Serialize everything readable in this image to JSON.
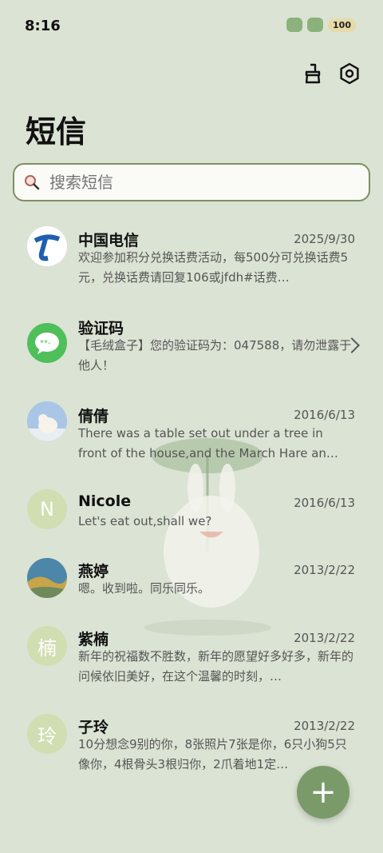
{
  "status": {
    "time": "8:16",
    "battery": "100"
  },
  "header": {
    "title": "短信"
  },
  "search": {
    "placeholder": "搜索短信"
  },
  "messages": [
    {
      "name": "中国电信",
      "date": "2025/9/30",
      "preview": "欢迎参加积分兑换话费活动，每500分可兑换话费5元，兑换话费请回复106或jfdh#话费…",
      "avatar": "telecom-logo"
    },
    {
      "name": "验证码",
      "date": "",
      "preview": "【毛绒盒子】您的验证码为：047588，请勿泄露于他人！",
      "avatar": "message-icon"
    },
    {
      "name": "倩倩",
      "date": "2016/6/13",
      "preview": "There was a table set out under a tree in front of the house,and the March Hare an…",
      "avatar": "polar-bear-photo"
    },
    {
      "name": "Nicole",
      "date": "2016/6/13",
      "preview": "Let's eat out,shall we?",
      "avatar_letter": "N"
    },
    {
      "name": "燕婷",
      "date": "2013/2/22",
      "preview": "嗯。收到啦。同乐同乐。",
      "avatar": "landscape-photo"
    },
    {
      "name": "紫楠",
      "date": "2013/2/22",
      "preview": "新年的祝福数不胜数，新年的愿望好多好多，新年的问候依旧美好，在这个温馨的时刻，…",
      "avatar_letter": "楠"
    },
    {
      "name": "子玲",
      "date": "2013/2/22",
      "preview": "10分想念9别的你，8张照片7张是你，6只小狗5只像你，4根骨头3根归你，2爪着地1定…",
      "avatar_letter": "玲"
    }
  ],
  "fab": {
    "label": "+"
  },
  "colors": {
    "background": "#dbe3d4",
    "accent": "#7a9a6a",
    "search_border": "#7f8f63"
  }
}
